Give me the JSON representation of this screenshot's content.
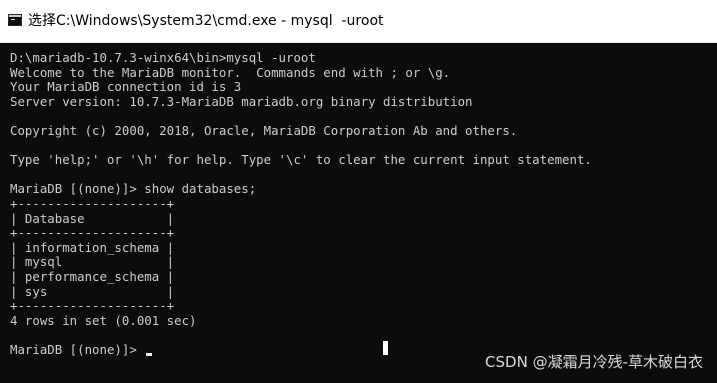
{
  "window": {
    "title": "选择C:\\Windows\\System32\\cmd.exe - mysql  -uroot",
    "icon": "cmd-window-icon"
  },
  "console": {
    "background": "#0c0c0c",
    "foreground": "#cccccc",
    "lines": [
      "D:\\mariadb-10.7.3-winx64\\bin>mysql -uroot",
      "Welcome to the MariaDB monitor.  Commands end with ; or \\g.",
      "Your MariaDB connection id is 3",
      "Server version: 10.7.3-MariaDB mariadb.org binary distribution",
      "",
      "Copyright (c) 2000, 2018, Oracle, MariaDB Corporation Ab and others.",
      "",
      "Type 'help;' or '\\h' for help. Type '\\c' to clear the current input statement.",
      "",
      "MariaDB [(none)]> show databases;",
      "+--------------------+",
      "| Database           |",
      "+--------------------+",
      "| information_schema |",
      "| mysql              |",
      "| performance_schema |",
      "| sys                |",
      "+--------------------+",
      "4 rows in set (0.001 sec)",
      ""
    ],
    "prompt": "MariaDB [(none)]> "
  },
  "watermark": "CSDN @凝霜月冷残-草木破白衣"
}
